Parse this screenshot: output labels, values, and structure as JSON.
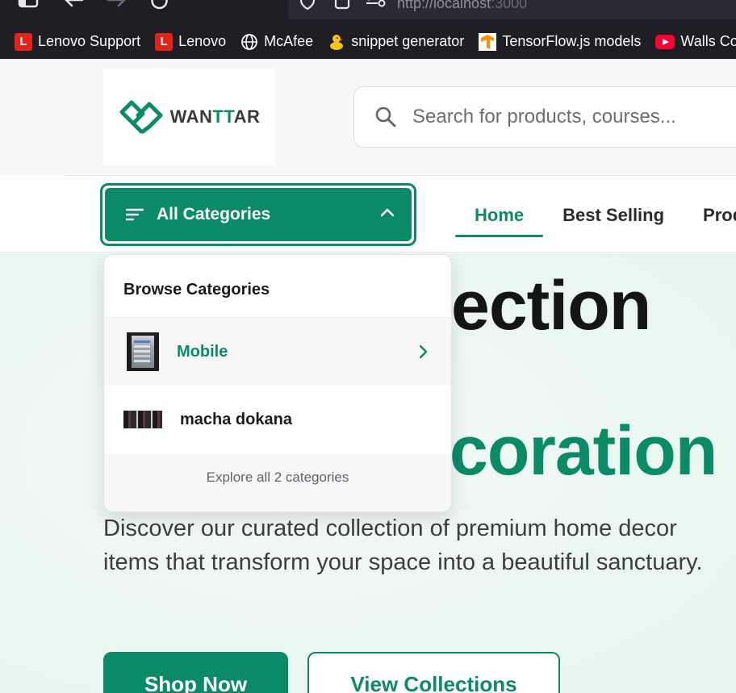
{
  "browser": {
    "url_host": "http://localhost",
    "url_port": ":3000",
    "bookmarks": [
      {
        "label": "Lenovo Support",
        "icon": "lenovo-icon",
        "color": "#e2231a"
      },
      {
        "label": "Lenovo",
        "icon": "lenovo-icon",
        "color": "#e2231a"
      },
      {
        "label": "McAfee",
        "icon": "globe-icon",
        "color": "#fbfbfe"
      },
      {
        "label": "snippet generator",
        "icon": "duck-icon",
        "color": "#f5c518"
      },
      {
        "label": "TensorFlow.js models",
        "icon": "tensorflow-icon",
        "color": "#ff8f00"
      },
      {
        "label": "Walls Col",
        "icon": "youtube-icon",
        "color": "#ff0033"
      }
    ]
  },
  "header": {
    "logo": {
      "prefix": "WAN",
      "accent": "TT",
      "suffix": "AR"
    },
    "search_placeholder": "Search for products, courses..."
  },
  "nav": {
    "categories_button": "All Categories",
    "links": [
      "Home",
      "Best Selling",
      "Prod"
    ],
    "active": "Home"
  },
  "dropdown": {
    "title": "Browse Categories",
    "items": [
      {
        "label": "Mobile",
        "active": true
      },
      {
        "label": "macha dokana",
        "active": false
      }
    ],
    "footer": "Explore all 2 categories"
  },
  "hero": {
    "line1": "ection",
    "line2": "coration",
    "description": "Discover our curated collection of premium home decor items that transform your space into a beautiful sanctuary.",
    "primary_button": "Shop Now",
    "secondary_button": "View Collections"
  },
  "colors": {
    "brand": "#0b8a68",
    "chrome": "#1f1e25"
  }
}
